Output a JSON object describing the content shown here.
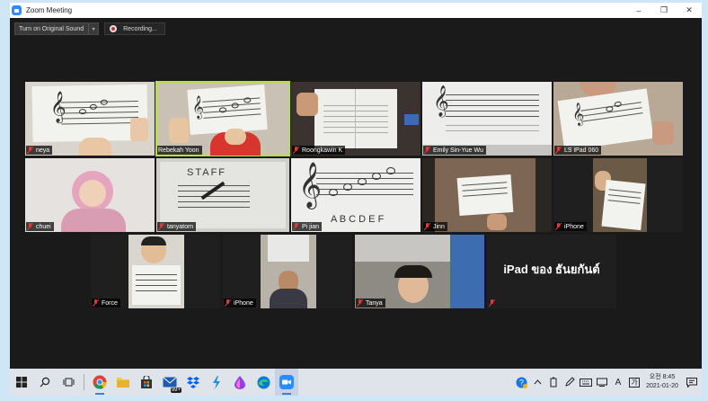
{
  "window": {
    "title": "Zoom Meeting",
    "controls": {
      "minimize": "–",
      "maximize": "❐",
      "close": "✕"
    }
  },
  "toolbar": {
    "original_sound_label": "Turn on Original Sound",
    "dropdown_glyph": "▾",
    "recording_label": "Recording..."
  },
  "participants": [
    {
      "name": "neya"
    },
    {
      "name": "Rebekah Yoon",
      "active": true
    },
    {
      "name": "Roongkawin K"
    },
    {
      "name": "Emily Sin-Yue Wu"
    },
    {
      "name": "LS iPad 060"
    },
    {
      "name": "chuei"
    },
    {
      "name": "tanyatorn"
    },
    {
      "name": "Pi jian"
    },
    {
      "name": "Jinn"
    },
    {
      "name": "iPhone"
    },
    {
      "name": "Force"
    },
    {
      "name": "iPhone"
    },
    {
      "name": "Tanya"
    },
    {
      "name": ""
    }
  ],
  "ipad_tile_text": "iPad ของ ธันยกันต์",
  "paper_text": {
    "staff_word": "STAFF",
    "letters": "A B C D E F"
  },
  "taskbar": {
    "apps": [
      "start-icon",
      "search-icon",
      "task-view-icon",
      "chrome-icon",
      "file-explorer-icon",
      "store-icon",
      "mail-icon",
      "dropbox-icon",
      "lightning-icon",
      "drop-icon",
      "edge-icon",
      "zoom-icon"
    ],
    "mail_badge": "99+",
    "tray": {
      "language": "A",
      "ime": "가"
    },
    "clock_time": "오전 8:45",
    "clock_date": "2021-01-20"
  },
  "colors": {
    "frame": "#cfe6f7",
    "meeting_bg": "#1a1a1a",
    "active_speaker": "#b6e23a",
    "mute_red": "#e03a3a",
    "zoom_blue": "#2d8cff"
  }
}
